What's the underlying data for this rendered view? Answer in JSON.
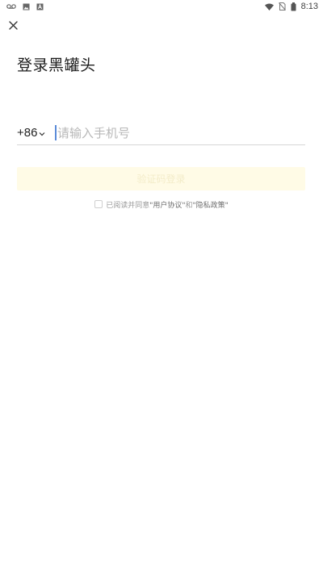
{
  "status_bar": {
    "time": "8:13",
    "left_icons": [
      "voicemail-icon",
      "image-icon",
      "text-icon"
    ],
    "right_icons": [
      "wifi-icon",
      "no-sim-icon",
      "battery-icon"
    ]
  },
  "page": {
    "title": "登录黑罐头"
  },
  "phone": {
    "country_code": "+86",
    "placeholder": "请输入手机号",
    "value": ""
  },
  "login": {
    "label": "验证码登录"
  },
  "agreement": {
    "prefix": "已阅读并同意",
    "user_agreement": "\"用户协议\"",
    "and": "和",
    "privacy_policy": "\"隐私政策\""
  },
  "colors": {
    "accent_caret": "#5b8bd8",
    "login_bg": "#fffbe6"
  }
}
